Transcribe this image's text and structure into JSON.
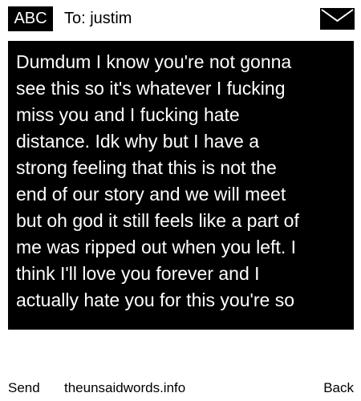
{
  "header": {
    "badge_label": "ABC",
    "to_text": "To: justim",
    "envelope_icon": "envelope-icon"
  },
  "message": {
    "text": "Dumdum I know you're not gonna\nsee this so it's whatever I fucking\nmiss you and I fucking hate\ndistance. Idk why but I have a\nstrong feeling that this is not the\nend of our story and we will meet\nbut oh god it still feels like a part of\nme was ripped out when you left. I\nthink I'll love you forever and I\nactually hate you for this you're so"
  },
  "footer": {
    "send_label": "Send",
    "site_label": "theunsaidwords.info",
    "back_label": "Back"
  },
  "colors": {
    "background": "#ffffff",
    "foreground": "#000000",
    "message_text": "#ffffff"
  }
}
